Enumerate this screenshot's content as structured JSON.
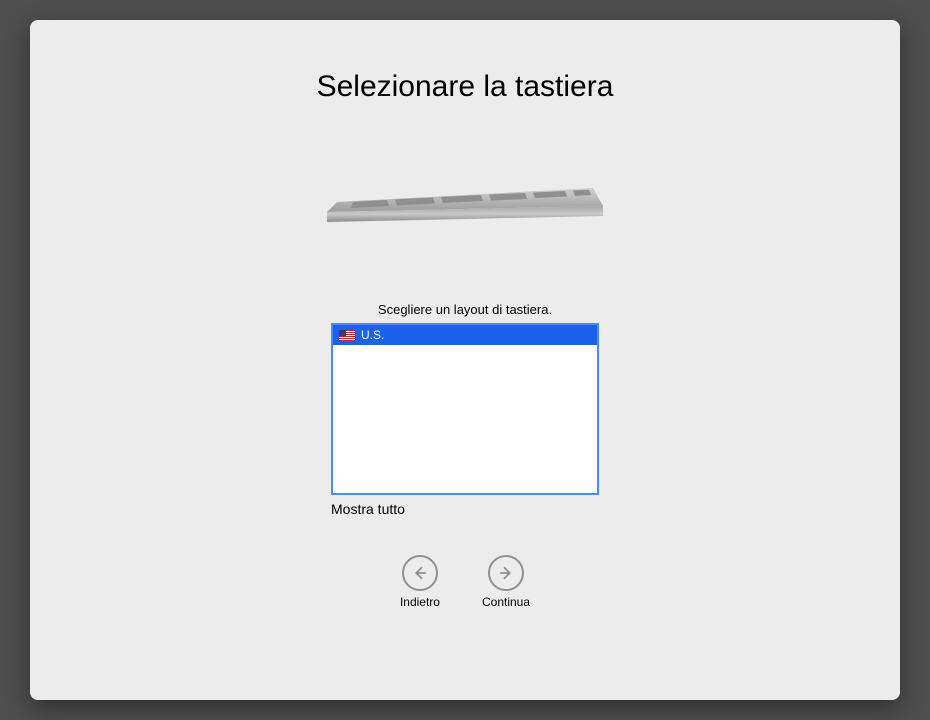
{
  "title": "Selezionare la tastiera",
  "instruction": "Scegliere un layout di tastiera.",
  "layouts": [
    {
      "label": "U.S.",
      "flag": "us",
      "selected": true
    }
  ],
  "show_all_label": "Mostra tutto",
  "back": {
    "label": "Indietro"
  },
  "continue": {
    "label": "Continua"
  }
}
